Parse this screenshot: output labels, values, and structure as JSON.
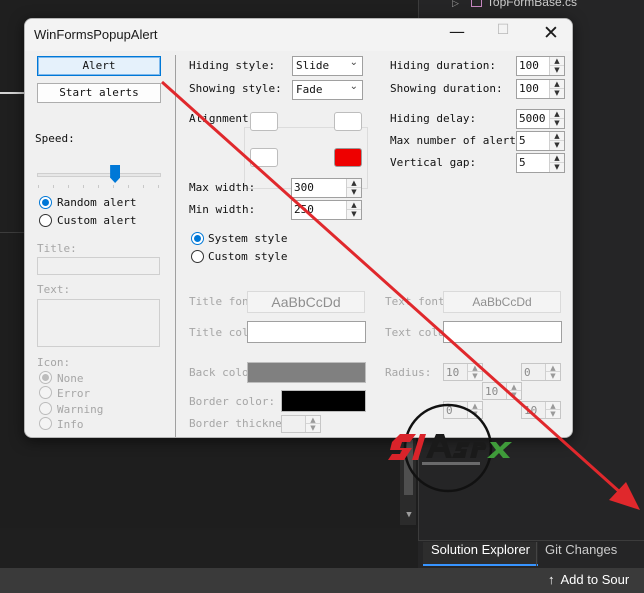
{
  "ide": {
    "tree_item": "TopFormBase.cs",
    "bottom_tabs": [
      "Solution Explorer",
      "Git Changes"
    ],
    "status_text": "Add to Sour"
  },
  "dialog": {
    "title": "WinFormsPopupAlert",
    "buttons": {
      "alert": "Alert",
      "start_alerts": "Start alerts"
    },
    "speed_label": "Speed:",
    "speed_value": 0.63,
    "mode": {
      "random": "Random alert",
      "custom": "Custom alert",
      "selected": "random"
    },
    "title_label": "Title:",
    "text_label": "Text:",
    "icon": {
      "label": "Icon:",
      "options": [
        "None",
        "Error",
        "Warning",
        "Info"
      ],
      "selected": "None"
    },
    "hiding_style": {
      "label": "Hiding style:",
      "value": "Slide"
    },
    "showing_style": {
      "label": "Showing style:",
      "value": "Fade"
    },
    "alignment_label": "Alignment:",
    "alignment_selected_color": "#ee0000",
    "max_width": {
      "label": "Max width:",
      "value": "300"
    },
    "min_width": {
      "label": "Min width:",
      "value": "250"
    },
    "style_mode": {
      "system": "System style",
      "custom": "Custom style",
      "selected": "system"
    },
    "title_font": {
      "label": "Title font:",
      "sample": "AaBbCcDd"
    },
    "text_font": {
      "label": "Text font:",
      "sample": "AaBbCcDd"
    },
    "title_color_label": "Title color:",
    "text_color_label": "Text color:",
    "back_color": {
      "label": "Back color:",
      "value": "#808080"
    },
    "border_color": {
      "label": "Border color:",
      "value": "#000000"
    },
    "border_thickness_label": "Border thickness:",
    "radius": {
      "label": "Radius:",
      "values": [
        "10",
        "0",
        "10",
        "0",
        "10"
      ]
    },
    "hiding_duration": {
      "label": "Hiding duration:",
      "value": "100"
    },
    "showing_duration": {
      "label": "Showing duration:",
      "value": "100"
    },
    "hiding_delay": {
      "label": "Hiding delay:",
      "value": "5000"
    },
    "max_alerts": {
      "label": "Max number of alerts:",
      "value": "5"
    },
    "vertical_gap": {
      "label": "Vertical gap:",
      "value": "5"
    }
  },
  "colors": {
    "accent": "#0078d7",
    "arrow": "#e0282c"
  }
}
